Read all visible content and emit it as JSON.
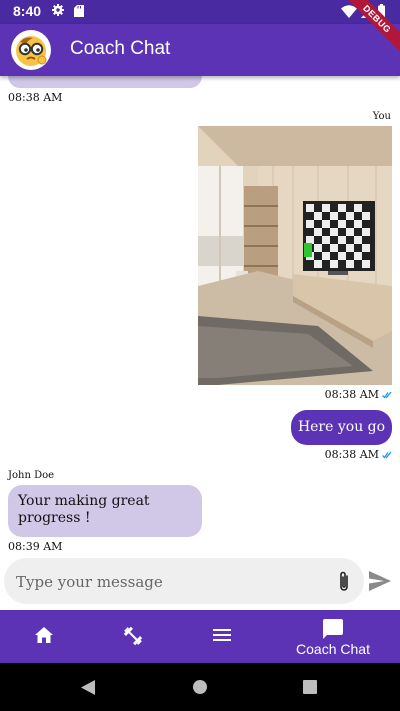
{
  "status_bar": {
    "time": "8:40",
    "debug_label": "DEBUG"
  },
  "app_bar": {
    "title": "Coach Chat",
    "avatar_icon": "nerd-face-emoji"
  },
  "messages": [
    {
      "type": "text",
      "from": "them",
      "time": "08:38 AM",
      "partial": true
    },
    {
      "type": "image",
      "from": "me",
      "sender": "You",
      "time": "08:38 AM",
      "read": true
    },
    {
      "type": "text",
      "from": "me",
      "text": "Here you go",
      "time": "08:38 AM",
      "read": true
    },
    {
      "type": "text",
      "from": "them",
      "sender": "John Doe",
      "text": "Your making great progress !",
      "time": "08:39 AM"
    }
  ],
  "composer": {
    "placeholder": "Type your message",
    "attach_icon": "paperclip-icon",
    "send_icon": "send-icon"
  },
  "bottom_nav": {
    "items": [
      {
        "icon": "home-icon",
        "label": ""
      },
      {
        "icon": "dumbbell-icon",
        "label": ""
      },
      {
        "icon": "menu-icon",
        "label": ""
      },
      {
        "icon": "chat-icon",
        "label": "Coach Chat",
        "active": true
      }
    ]
  },
  "colors": {
    "primary": "#5c33b5",
    "status_bar": "#4a2aa0",
    "bubble_them": "#d1c7e7",
    "composer_bg": "#efefef",
    "read_check": "#2196f3"
  }
}
